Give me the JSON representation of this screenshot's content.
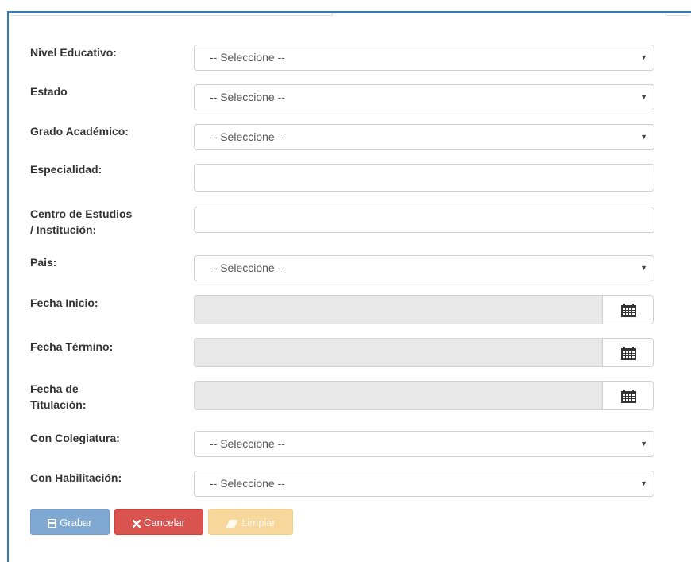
{
  "form": {
    "fields": [
      {
        "label": "Nivel Educativo:",
        "type": "select",
        "value": "-- Seleccione --"
      },
      {
        "label": "Estado",
        "type": "select",
        "value": "-- Seleccione --"
      },
      {
        "label": "Grado Académico:",
        "type": "select",
        "value": "-- Seleccione --"
      },
      {
        "label": "Especialidad:",
        "type": "text",
        "value": ""
      },
      {
        "label_line1": "Centro de Estudios",
        "label_line2": "/ Institución:",
        "type": "text",
        "value": ""
      },
      {
        "label": "Pais:",
        "type": "select",
        "value": "-- Seleccione --"
      },
      {
        "label": "Fecha Inicio:",
        "type": "date",
        "value": ""
      },
      {
        "label": "Fecha Término:",
        "type": "date",
        "value": ""
      },
      {
        "label_line1": "Fecha de",
        "label_line2": "Titulación:",
        "type": "date",
        "value": ""
      },
      {
        "label": "Con Colegiatura:",
        "type": "select",
        "value": "-- Seleccione --"
      },
      {
        "label": "Con Habilitación:",
        "type": "select",
        "value": "-- Seleccione --"
      }
    ],
    "dropdown_caret": "▼",
    "calendar_icon": "calendar-icon"
  },
  "actions": {
    "grabar": {
      "label": "Grabar",
      "icon": "floppy-disk-icon",
      "color": "#7fa9d3"
    },
    "cancelar": {
      "label": "Cancelar",
      "icon": "close-icon",
      "color": "#d9534f"
    },
    "limpiar": {
      "label": "Limpiar",
      "icon": "eraser-icon",
      "color": "#f7d79b"
    }
  },
  "colors": {
    "panel_border": "#337ab7",
    "readonly_bg": "#e8e8e8"
  }
}
